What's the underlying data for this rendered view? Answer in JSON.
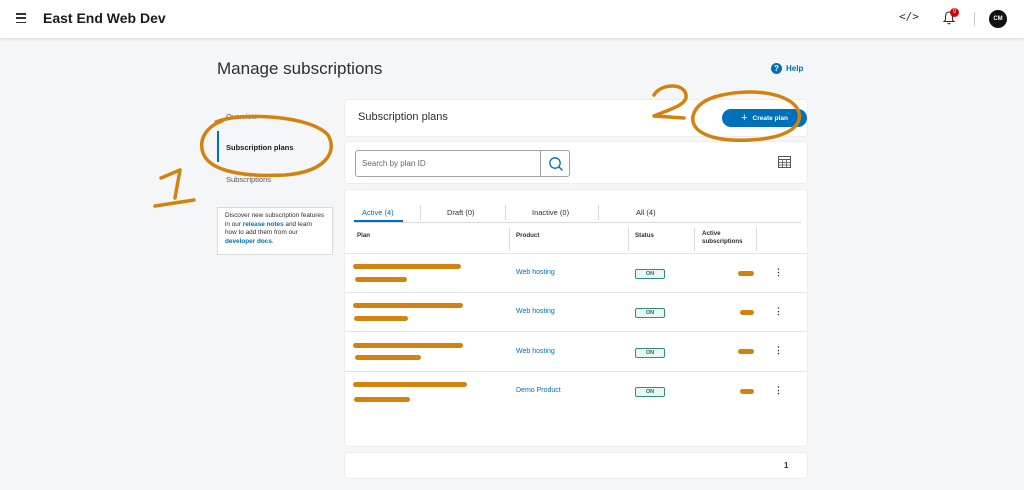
{
  "header": {
    "app_title": "East End Web Dev",
    "notification_count": "0",
    "avatar_initials": "CM",
    "icons": [
      "menu-icon",
      "code-icon",
      "bell-icon"
    ]
  },
  "page": {
    "title": "Manage subscriptions",
    "help_label": "Help"
  },
  "sidebar": {
    "items": [
      {
        "label": "Overview"
      },
      {
        "label": "Subscription plans"
      },
      {
        "label": "Subscriptions"
      }
    ],
    "info": {
      "text_1": "Discover new subscription features in our ",
      "link_1": "release notes",
      "text_2": " and learn how to add them from our ",
      "link_2": "developer docs",
      "text_3": "."
    }
  },
  "plans": {
    "title": "Subscription plans",
    "create_label": "Create plan",
    "search_placeholder": "Search by plan ID",
    "tabs": [
      {
        "label": "Active (4)"
      },
      {
        "label": "Draft (0)"
      },
      {
        "label": "Inactive (0)"
      },
      {
        "label": "All (4)"
      }
    ],
    "columns": {
      "plan": "Plan",
      "product": "Product",
      "status": "Status",
      "active_subs": "Active subscriptions"
    },
    "rows": [
      {
        "product": "Web hosting",
        "status": "ON"
      },
      {
        "product": "Web hosting",
        "status": "ON"
      },
      {
        "product": "Web hosting",
        "status": "ON"
      },
      {
        "product": "Demo Product",
        "status": "ON"
      }
    ],
    "page_number": "1"
  },
  "annotations": {
    "label_1": "1",
    "label_2": "2",
    "color": "#d4820f"
  },
  "colors": {
    "accent": "#0070ba",
    "status_on": "#2d8f7f"
  }
}
